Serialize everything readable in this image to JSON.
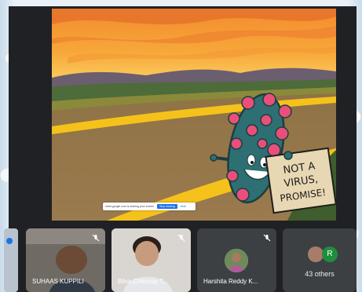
{
  "slide": {
    "sign_line1": "NOT A",
    "sign_line2": "VIRUS,",
    "sign_line3": "PROMISE!"
  },
  "share_bar": {
    "message": "meet.google.com is sharing your screen",
    "stop_label": "Stop sharing",
    "hide_label": "Hide"
  },
  "participants": [
    {
      "name": "SUHAAS KUPPILI",
      "muted": true
    },
    {
      "name": "Bilva Chinmay T...",
      "muted": true
    },
    {
      "name": "Harshita Reddy K...",
      "muted": true
    }
  ],
  "others": {
    "label": "43 others",
    "avatar_letter": "R"
  },
  "colors": {
    "meet_bg": "#202124",
    "tile_bg": "#3c4043",
    "virus_body": "#2e6f73",
    "virus_spikes": "#e94f7a",
    "road": "#8a6a47",
    "road_lines": "#f5c21b"
  }
}
